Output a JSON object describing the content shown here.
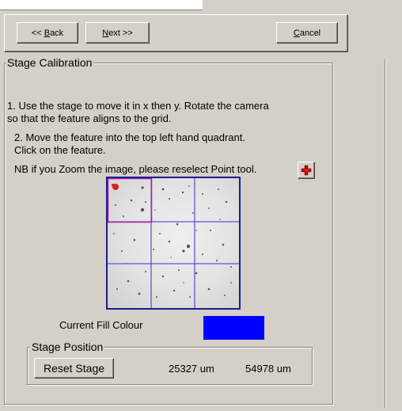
{
  "nav": {
    "back_label": "<< Back",
    "next_label": "Next >>",
    "cancel_label": "Cancel"
  },
  "calibration": {
    "group_title": "Stage Calibration",
    "instruction_1a": "1. Use the stage to move it in x then y. Rotate the camera",
    "instruction_1b": "so that the feature aligns to the grid.",
    "instruction_2a": "2. Move the feature into the top left hand quadrant.",
    "instruction_2b": "Click on the feature.",
    "nb_text": "NB if you Zoom the image, please reselect Point tool.",
    "point_tool_icon": "red-cross-point-icon",
    "point_tool_color": "#cc0000",
    "fill_colour_label": "Current Fill Colour",
    "fill_colour": "#0000ff",
    "grid_color": "#3a2fd0",
    "highlight_color": "#b01fae"
  },
  "stage_position": {
    "group_title": "Stage Position",
    "reset_label": "Reset Stage",
    "x_value": "25327 um",
    "y_value": "54978 um"
  }
}
